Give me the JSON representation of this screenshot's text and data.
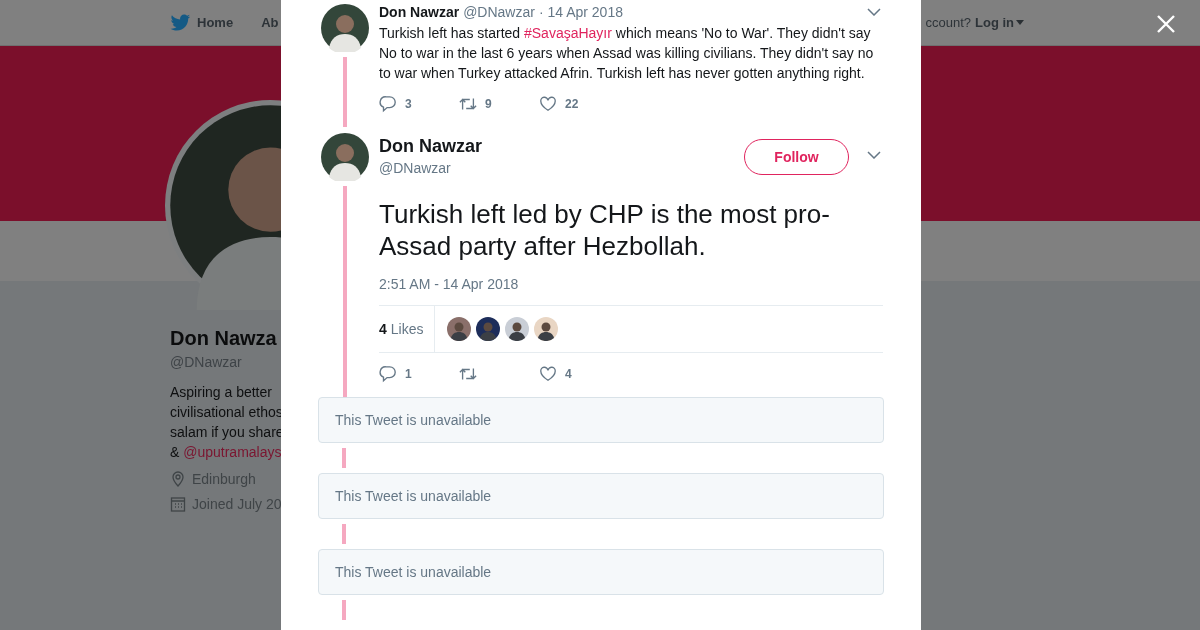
{
  "nav": {
    "items": [
      {
        "label": "Home"
      },
      {
        "label": "Ab"
      }
    ],
    "account_prompt": "ccount?",
    "login": "Log in"
  },
  "profile": {
    "name": "Don Nawza",
    "handle": "@DNawzar",
    "bio_lines": [
      "Aspiring a better",
      "civilisational ethos",
      "salam if you share"
    ],
    "bio_last": {
      "prefix": "&",
      "mention": "@uputramalays"
    },
    "location": "Edinburgh",
    "joined": "Joined July 20"
  },
  "parent_tweet": {
    "name": "Don Nawzar",
    "handle": "@DNawzar",
    "date": "· 14 Apr 2018",
    "text": [
      {
        "kind": "plain",
        "text": "Turkish left has started "
      },
      {
        "kind": "hashtag",
        "text": "#SavaşaHayır"
      },
      {
        "kind": "plain",
        "text": " which means 'No to War'. They didn't say No to war in the last 6 years when Assad was killing civilians. They didn't say no to war when Turkey attacked Afrin. Turkish left has never gotten anything right."
      }
    ],
    "replies": "3",
    "retweets": "9",
    "likes": "22"
  },
  "main_tweet": {
    "name": "Don Nawzar",
    "handle": "@DNawzar",
    "follow": "Follow",
    "text": "Turkish left led by CHP is the most pro-Assad party after Hezbollah.",
    "timestamp": "2:51 AM - 14 Apr 2018",
    "like_count": "4",
    "like_label": "Likes",
    "replies": "1",
    "likes": "4"
  },
  "unavailable": [
    "This Tweet is unavailable",
    "This Tweet is unavailable",
    "This Tweet is unavailable"
  ]
}
